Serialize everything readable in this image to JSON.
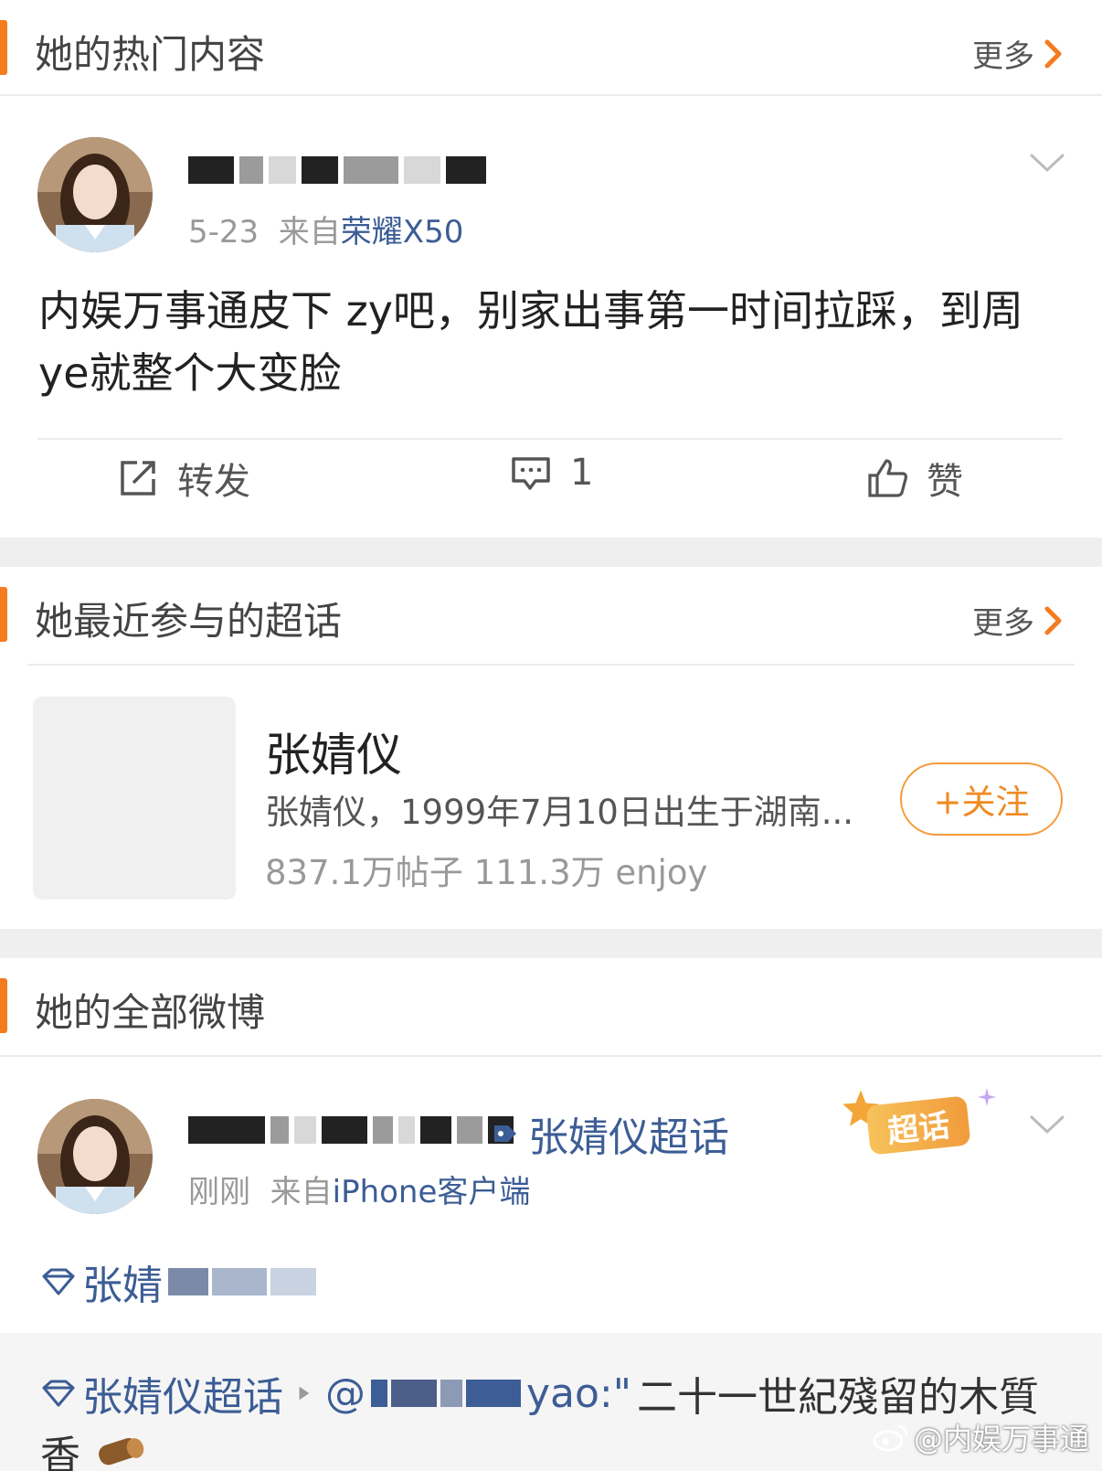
{
  "hot": {
    "title": "她的热门内容",
    "more": "更多",
    "post": {
      "date": "5-23",
      "from_prefix": "来自",
      "source": "荣耀X50",
      "text_line1": "内娱万事通皮下 zy吧，别家出事第一时间拉踩，到周",
      "text_line2": "ye就整个大变脸",
      "repost_label": "转发",
      "comment_count": "1",
      "like_label": "赞"
    }
  },
  "supertopics": {
    "title": "她最近参与的超话",
    "more": "更多",
    "item": {
      "name": "张婧仪",
      "desc": "张婧仪，1999年7月10日出生于湖南...",
      "stats": "837.1万帖子 111.3万 enjoy",
      "follow_label": "+关注"
    }
  },
  "all": {
    "title": "她的全部微博",
    "post": {
      "topic_link": "张婧仪超话",
      "badge": "超话",
      "time": "刚刚",
      "from_prefix": "来自",
      "source": "iPhone客户端",
      "tag_partial": "张婧",
      "repost_topic": "张婧仪超话",
      "repost_at": "@",
      "repost_user_tail": "yao:\"",
      "repost_text": " 二十一世紀殘留的木質",
      "repost_line2": "香",
      "repost_line2_tail": "_"
    }
  },
  "watermark": "@内娱万事通",
  "colors": {
    "accent": "#f47b20",
    "link": "#3c5d95",
    "follow": "#f08a21"
  }
}
